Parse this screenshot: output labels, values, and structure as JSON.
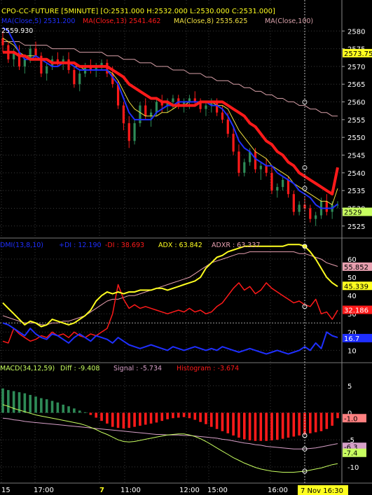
{
  "colors": {
    "background": "#000000",
    "grid": "#3a3a3a",
    "up_candle": "#2e8b57",
    "down_candle": "#ff1a1a",
    "ma5": "#1f2fff",
    "ma13": "#ff1a1a",
    "ma8": "#f0e040",
    "ma100": "#d7a0a8",
    "plus_di": "#1f2fff",
    "minus_di": "#ff1a1a",
    "adx": "#ffff20",
    "adxr": "#e8a0b0",
    "macd_diff": "#c8ff60",
    "macd_signal": "#d7a0c8",
    "hist_pos": "#2e8b57",
    "hist_neg": "#ff1a1a",
    "crosshair": "#bbbbbb"
  },
  "price_panel": {
    "header": "CPO-CC-FUTURE [5MINUTE] [O:2531.000 H:2532.000 L:2530.000 C:2531.000]",
    "ma_labels": [
      {
        "text": "MA(Close,5)  2531.200",
        "color": "#1f2fff"
      },
      {
        "text": "MA(Close,13)  2541.462",
        "color": "#ff1a1a"
      },
      {
        "text": "MA(Close,8)  2535.625",
        "color": "#f0e040"
      },
      {
        "text": "MA(Close,100)",
        "color": "#d7a0a8"
      }
    ],
    "price_flag": "2559.930",
    "axis_ticks": [
      "2580",
      "2575",
      "2570",
      "2565",
      "2560",
      "2555",
      "2550",
      "2545",
      "2540",
      "2535",
      "2530",
      "2525"
    ],
    "marker_ma100": "2573.75",
    "marker_last": "2529"
  },
  "dmi_panel": {
    "labels": [
      {
        "text": "DMI(13,8,10)",
        "color": "#1f2fff"
      },
      {
        "text": "+DI : 12.190",
        "color": "#1f2fff"
      },
      {
        "text": "-DI : 38.693",
        "color": "#ff1a1a"
      },
      {
        "text": "ADX : 63.842",
        "color": "#ffff20"
      },
      {
        "text": "ADXR : 63.337",
        "color": "#e8a0b0"
      }
    ],
    "axis_ticks": [
      "60",
      "50",
      "40",
      "30",
      "20",
      "10"
    ],
    "markers": [
      {
        "text": "55.852",
        "bg": "#e8a0b0"
      },
      {
        "text": "45.339",
        "bg": "#ffff20"
      },
      {
        "text": "32.186",
        "bg": "#ff1a1a"
      },
      {
        "text": "16.7",
        "bg": "#1f2fff"
      }
    ]
  },
  "macd_panel": {
    "labels": [
      {
        "text": "MACD(34,12,59)",
        "color": "#c8ff60"
      },
      {
        "text": "Diff : -9.408",
        "color": "#c8ff60"
      },
      {
        "text": "Signal : -5.734",
        "color": "#d7a0c8"
      },
      {
        "text": "Histogram : -3.674",
        "color": "#ff1a1a"
      }
    ],
    "axis_ticks": [
      "5",
      "0",
      "-5",
      "-10"
    ],
    "markers": [
      {
        "text": "-1.0",
        "bg": "#ff8080"
      },
      {
        "text": "-6.3",
        "bg": "#d7a0c8"
      },
      {
        "text": "-7.4",
        "bg": "#c8ff60"
      }
    ]
  },
  "x_axis": {
    "labels": [
      "15",
      "17:00",
      "7",
      "11:00",
      "12:00",
      "15:00",
      "16:00"
    ],
    "crosshair_label": "7 Nov 16:30"
  },
  "chart_data": {
    "type": "line",
    "title": "CPO-CC-FUTURE [5MINUTE]",
    "ohlc_last": {
      "open": 2531.0,
      "high": 2532.0,
      "low": 2530.0,
      "close": 2531.0
    },
    "price_range": [
      2522,
      2584
    ],
    "candles": [
      [
        2578,
        2580,
        2574,
        2576
      ],
      [
        2576,
        2577,
        2571,
        2572
      ],
      [
        2572,
        2575,
        2570,
        2574
      ],
      [
        2574,
        2576,
        2569,
        2570
      ],
      [
        2570,
        2573,
        2568,
        2572
      ],
      [
        2572,
        2576,
        2571,
        2575
      ],
      [
        2575,
        2577,
        2572,
        2573
      ],
      [
        2573,
        2574,
        2567,
        2568
      ],
      [
        2568,
        2571,
        2566,
        2570
      ],
      [
        2570,
        2573,
        2569,
        2572
      ],
      [
        2572,
        2574,
        2570,
        2571
      ],
      [
        2571,
        2573,
        2569,
        2572
      ],
      [
        2572,
        2574,
        2568,
        2569
      ],
      [
        2569,
        2570,
        2564,
        2565
      ],
      [
        2565,
        2569,
        2563,
        2568
      ],
      [
        2568,
        2571,
        2567,
        2570
      ],
      [
        2570,
        2572,
        2568,
        2569
      ],
      [
        2569,
        2571,
        2567,
        2570
      ],
      [
        2570,
        2572,
        2569,
        2571
      ],
      [
        2571,
        2572,
        2567,
        2568
      ],
      [
        2568,
        2570,
        2564,
        2565
      ],
      [
        2565,
        2566,
        2558,
        2559
      ],
      [
        2559,
        2560,
        2552,
        2554
      ],
      [
        2554,
        2556,
        2547,
        2549
      ],
      [
        2549,
        2555,
        2548,
        2554
      ],
      [
        2554,
        2560,
        2553,
        2559
      ],
      [
        2559,
        2561,
        2555,
        2556
      ],
      [
        2556,
        2558,
        2553,
        2557
      ],
      [
        2557,
        2561,
        2556,
        2560
      ],
      [
        2560,
        2562,
        2557,
        2559
      ],
      [
        2559,
        2561,
        2557,
        2560
      ],
      [
        2560,
        2562,
        2558,
        2561
      ],
      [
        2561,
        2562,
        2558,
        2559
      ],
      [
        2559,
        2561,
        2557,
        2560
      ],
      [
        2560,
        2562,
        2558,
        2561
      ],
      [
        2561,
        2563,
        2559,
        2560
      ],
      [
        2560,
        2561,
        2557,
        2558
      ],
      [
        2558,
        2560,
        2556,
        2559
      ],
      [
        2559,
        2561,
        2557,
        2560
      ],
      [
        2560,
        2561,
        2556,
        2557
      ],
      [
        2557,
        2559,
        2554,
        2555
      ],
      [
        2555,
        2557,
        2550,
        2551
      ],
      [
        2551,
        2553,
        2545,
        2546
      ],
      [
        2546,
        2548,
        2539,
        2540
      ],
      [
        2540,
        2544,
        2539,
        2543
      ],
      [
        2543,
        2547,
        2542,
        2546
      ],
      [
        2546,
        2547,
        2540,
        2541
      ],
      [
        2541,
        2543,
        2538,
        2542
      ],
      [
        2542,
        2544,
        2539,
        2540
      ],
      [
        2540,
        2542,
        2534,
        2535
      ],
      [
        2535,
        2537,
        2533,
        2536
      ],
      [
        2536,
        2539,
        2535,
        2538
      ],
      [
        2538,
        2539,
        2533,
        2534
      ],
      [
        2534,
        2535,
        2528,
        2529
      ],
      [
        2529,
        2532,
        2528,
        2531
      ],
      [
        2531,
        2533,
        2529,
        2530
      ],
      [
        2530,
        2531,
        2526,
        2527
      ],
      [
        2527,
        2529,
        2525,
        2528
      ],
      [
        2528,
        2533,
        2527,
        2532
      ],
      [
        2532,
        2534,
        2528,
        2529
      ],
      [
        2529,
        2532,
        2527,
        2531
      ],
      [
        2531,
        2532,
        2530,
        2531
      ]
    ],
    "series": [
      {
        "name": "MA(Close,5)",
        "values": [
          2581,
          2580,
          2577,
          2574,
          2572,
          2572,
          2573,
          2572,
          2571,
          2570,
          2570,
          2571,
          2571,
          2570,
          2569,
          2569,
          2569,
          2569,
          2569,
          2569,
          2567,
          2565,
          2561,
          2557,
          2555,
          2555,
          2555,
          2555,
          2557,
          2558,
          2559,
          2559,
          2560,
          2560,
          2560,
          2560,
          2560,
          2560,
          2559,
          2559,
          2558,
          2556,
          2553,
          2549,
          2547,
          2546,
          2544,
          2543,
          2542,
          2542,
          2540,
          2539,
          2538,
          2537,
          2535,
          2534,
          2533,
          2531,
          2530,
          2530,
          2530,
          2531.2
        ]
      },
      {
        "name": "MA(Close,13)",
        "values": [
          2574,
          2574,
          2574,
          2573,
          2573,
          2572,
          2572,
          2572,
          2572,
          2571,
          2571,
          2571,
          2571,
          2571,
          2570,
          2570,
          2570,
          2570,
          2570,
          2570,
          2569,
          2568,
          2567,
          2565,
          2564,
          2563,
          2562,
          2561,
          2561,
          2560,
          2560,
          2559,
          2559,
          2559,
          2559,
          2559,
          2560,
          2560,
          2560,
          2560,
          2560,
          2559,
          2558,
          2557,
          2556,
          2554,
          2553,
          2551,
          2549,
          2548,
          2546,
          2545,
          2543,
          2542,
          2540,
          2539,
          2538,
          2537,
          2536,
          2535,
          2534,
          2541.5
        ]
      },
      {
        "name": "MA(Close,8)",
        "values": [
          2578,
          2577,
          2576,
          2574,
          2573,
          2573,
          2573,
          2572,
          2572,
          2571,
          2571,
          2571,
          2571,
          2570,
          2570,
          2569,
          2569,
          2569,
          2569,
          2569,
          2568,
          2566,
          2563,
          2560,
          2558,
          2557,
          2556,
          2556,
          2556,
          2557,
          2557,
          2558,
          2559,
          2559,
          2560,
          2560,
          2560,
          2560,
          2560,
          2559,
          2559,
          2558,
          2555,
          2552,
          2550,
          2548,
          2546,
          2545,
          2544,
          2542,
          2541,
          2540,
          2539,
          2537,
          2536,
          2535,
          2534,
          2533,
          2532,
          2532,
          2531,
          2535.6
        ]
      },
      {
        "name": "MA(Close,100)",
        "values": [
          2577,
          2577,
          2577,
          2577,
          2576,
          2576,
          2576,
          2576,
          2576,
          2575,
          2575,
          2575,
          2575,
          2575,
          2574,
          2574,
          2574,
          2574,
          2574,
          2573,
          2573,
          2573,
          2572,
          2572,
          2572,
          2571,
          2571,
          2571,
          2570,
          2570,
          2570,
          2569,
          2569,
          2569,
          2568,
          2568,
          2568,
          2567,
          2567,
          2566,
          2566,
          2566,
          2565,
          2565,
          2564,
          2564,
          2563,
          2563,
          2562,
          2562,
          2561,
          2561,
          2560,
          2560,
          2559,
          2559,
          2558,
          2558,
          2557,
          2557,
          2556,
          2556
        ]
      }
    ],
    "dmi": {
      "range": [
        4,
        70
      ],
      "plus_di": [
        25,
        24,
        22,
        20,
        18,
        22,
        19,
        17,
        16,
        19,
        18,
        16,
        14,
        17,
        19,
        17,
        15,
        18,
        17,
        16,
        14,
        17,
        15,
        13,
        12,
        11,
        12,
        13,
        12,
        11,
        10,
        12,
        11,
        10,
        11,
        12,
        11,
        10,
        11,
        10,
        12,
        11,
        10,
        9,
        10,
        11,
        10,
        9,
        8,
        9,
        10,
        9,
        8,
        9,
        10,
        12,
        10,
        14,
        11,
        20,
        18,
        17
      ],
      "minus_di": [
        15,
        14,
        22,
        19,
        17,
        15,
        16,
        18,
        17,
        20,
        18,
        19,
        17,
        20,
        18,
        17,
        19,
        18,
        20,
        22,
        30,
        46,
        38,
        33,
        35,
        33,
        34,
        33,
        32,
        31,
        30,
        31,
        32,
        31,
        33,
        31,
        32,
        30,
        31,
        34,
        36,
        40,
        44,
        47,
        43,
        45,
        41,
        43,
        47,
        44,
        42,
        40,
        38,
        36,
        37,
        35,
        34,
        38,
        30,
        31,
        27,
        32
      ],
      "adx": [
        36,
        33,
        30,
        27,
        24,
        26,
        25,
        23,
        24,
        27,
        26,
        25,
        24,
        25,
        27,
        29,
        32,
        37,
        40,
        42,
        41,
        42,
        41,
        42,
        42,
        43,
        43,
        43,
        44,
        44,
        43,
        44,
        45,
        46,
        47,
        48,
        50,
        55,
        58,
        61,
        62,
        64,
        65,
        66,
        67,
        67,
        67,
        67,
        67,
        67,
        67,
        67,
        68,
        68,
        68,
        67,
        64,
        60,
        55,
        50,
        47,
        45
      ],
      "adxr": [
        29,
        28,
        27,
        26,
        25,
        25,
        25,
        24,
        24,
        25,
        25,
        26,
        26,
        27,
        28,
        29,
        31,
        33,
        35,
        37,
        38,
        38,
        39,
        40,
        40,
        41,
        42,
        43,
        44,
        45,
        46,
        47,
        48,
        49,
        50,
        52,
        54,
        56,
        58,
        59,
        60,
        61,
        62,
        63,
        63,
        64,
        64,
        64,
        64,
        64,
        64,
        64,
        64,
        64,
        63,
        63,
        62,
        61,
        60,
        58,
        57,
        56
      ]
    },
    "macd": {
      "range": [
        -13,
        9
      ],
      "histogram": [
        4.5,
        4.2,
        4.0,
        3.8,
        3.6,
        3.3,
        3.0,
        2.7,
        2.5,
        2.2,
        1.9,
        1.5,
        1.2,
        0.8,
        0.4,
        0.1,
        -0.4,
        -0.9,
        -1.5,
        -2.0,
        -2.6,
        -2.8,
        -2.9,
        -2.8,
        -2.6,
        -2.4,
        -2.2,
        -2.0,
        -1.8,
        -1.5,
        -1.2,
        -1.0,
        -0.9,
        -0.8,
        -1.0,
        -1.3,
        -1.7,
        -2.1,
        -2.6,
        -3.0,
        -3.4,
        -3.8,
        -4.2,
        -4.6,
        -4.9,
        -5.1,
        -5.2,
        -5.2,
        -5.2,
        -5.1,
        -5.0,
        -4.8,
        -4.6,
        -4.4,
        -4.2,
        -4.0,
        -3.8,
        -3.6,
        -3.4,
        -3.0,
        -2.4,
        -1.0
      ],
      "diff": [
        1.5,
        1.2,
        0.8,
        0.5,
        0.2,
        -0.1,
        -0.4,
        -0.6,
        -0.8,
        -1.0,
        -1.2,
        -1.4,
        -1.6,
        -1.8,
        -2.0,
        -2.3,
        -2.7,
        -3.1,
        -3.6,
        -4.0,
        -4.5,
        -5.0,
        -5.3,
        -5.4,
        -5.3,
        -5.1,
        -4.9,
        -4.7,
        -4.5,
        -4.3,
        -4.1,
        -4.0,
        -3.9,
        -3.9,
        -4.1,
        -4.4,
        -4.8,
        -5.3,
        -5.9,
        -6.5,
        -7.1,
        -7.7,
        -8.3,
        -8.8,
        -9.3,
        -9.7,
        -10.1,
        -10.4,
        -10.6,
        -10.8,
        -10.9,
        -11.0,
        -11.0,
        -11.0,
        -10.9,
        -10.8,
        -10.6,
        -10.4,
        -10.2,
        -9.9,
        -9.6,
        -9.4
      ],
      "signal": [
        -1.0,
        -1.1,
        -1.3,
        -1.4,
        -1.6,
        -1.7,
        -1.8,
        -1.9,
        -2.0,
        -2.1,
        -2.2,
        -2.3,
        -2.4,
        -2.5,
        -2.6,
        -2.7,
        -2.8,
        -2.9,
        -3.0,
        -3.1,
        -3.2,
        -3.3,
        -3.4,
        -3.5,
        -3.6,
        -3.7,
        -3.8,
        -3.9,
        -4.0,
        -4.0,
        -4.1,
        -4.1,
        -4.1,
        -4.2,
        -4.2,
        -4.3,
        -4.4,
        -4.5,
        -4.6,
        -4.7,
        -4.9,
        -5.0,
        -5.2,
        -5.4,
        -5.6,
        -5.7,
        -5.9,
        -6.0,
        -6.2,
        -6.3,
        -6.4,
        -6.5,
        -6.6,
        -6.7,
        -6.7,
        -6.7,
        -6.6,
        -6.5,
        -6.3,
        -6.1,
        -5.9,
        -5.7
      ]
    }
  }
}
